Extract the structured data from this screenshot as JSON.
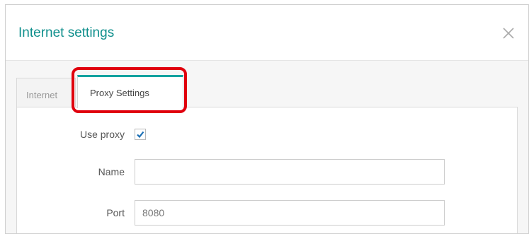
{
  "dialog": {
    "title": "Internet settings",
    "close_icon": "close-icon"
  },
  "tabs": [
    {
      "label": "Internet",
      "active": false
    },
    {
      "label": "Proxy Settings",
      "active": true
    }
  ],
  "form": {
    "use_proxy": {
      "label": "Use proxy",
      "checked": true
    },
    "name": {
      "label": "Name",
      "value": ""
    },
    "port": {
      "label": "Port",
      "value": "8080"
    }
  },
  "colors": {
    "accent": "#0f8f8c",
    "highlight": "#e0000d",
    "checkmark": "#1a6fb5"
  }
}
